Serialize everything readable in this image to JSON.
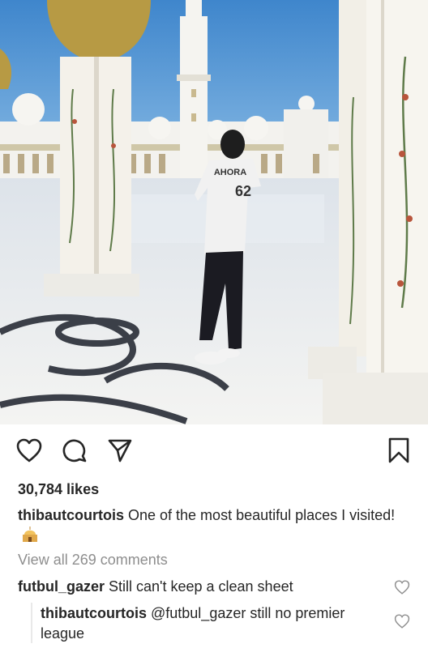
{
  "post": {
    "likes": "30,784 likes",
    "caption_user": "thibautcourtois",
    "caption_text": " One of the most beautiful places I visited!",
    "view_all": "View all 269 comments",
    "jersey": {
      "name": "AHORA",
      "number": "62"
    }
  },
  "comments": [
    {
      "user": "futbul_gazer",
      "text": " Still can't keep a clean sheet"
    },
    {
      "user": "thibautcourtois",
      "text": " @futbul_gazer still no premier league"
    }
  ],
  "icons": {
    "like": "heart-outline-icon",
    "comment": "speech-bubble-icon",
    "share": "paper-plane-icon",
    "save": "bookmark-icon",
    "caption_emoji": "mosque-emoji-icon",
    "comment_like": "small-heart-icon"
  },
  "colors": {
    "text": "#262626",
    "muted": "#8e8e8e",
    "sky": "#4a90cf"
  }
}
